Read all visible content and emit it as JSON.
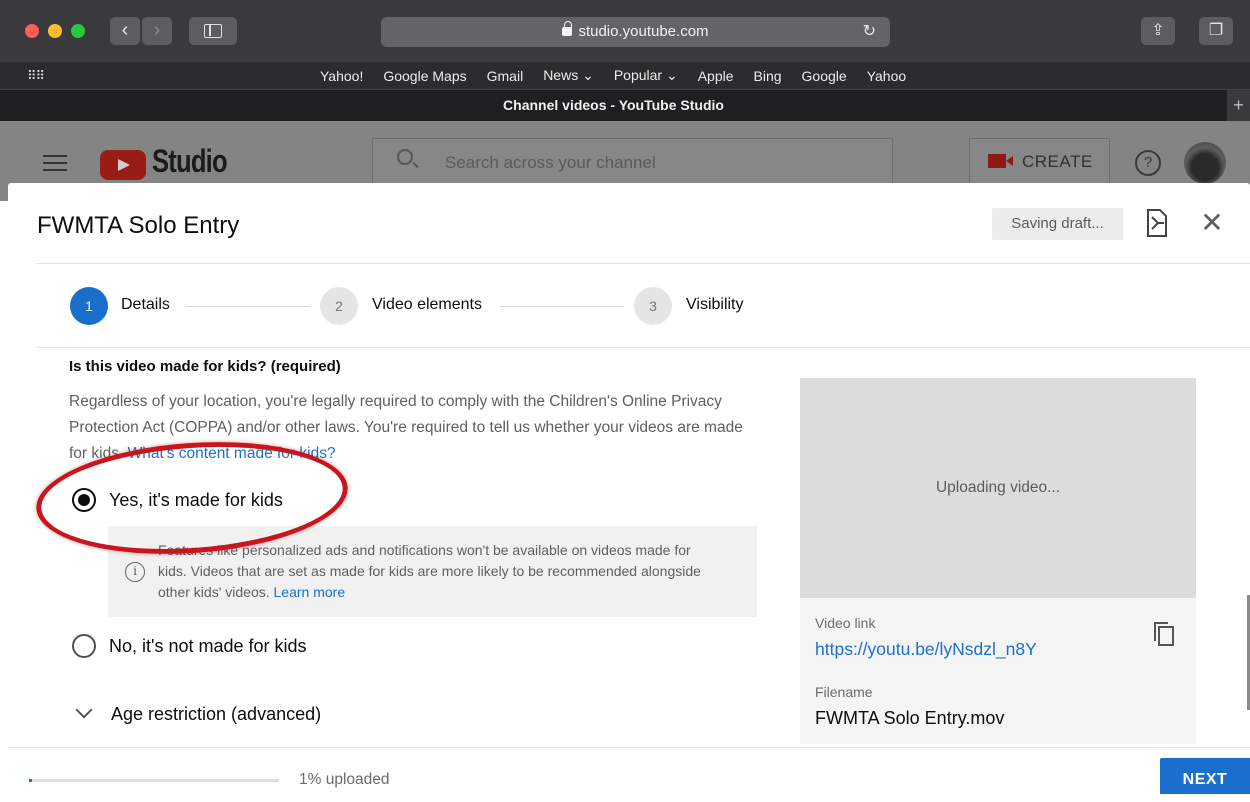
{
  "browser": {
    "url": "studio.youtube.com",
    "favorites": [
      "Yahoo!",
      "Google Maps",
      "Gmail",
      "News ⌄",
      "Popular ⌄",
      "Apple",
      "Bing",
      "Google",
      "Yahoo"
    ],
    "tab_title": "Channel videos - YouTube Studio",
    "traffic_colors": {
      "close": "#fe5f57",
      "minimize": "#febc2e",
      "zoom": "#28c840"
    }
  },
  "studio": {
    "brand": "Studio",
    "search_placeholder": "Search across your channel",
    "create_label": "CREATE",
    "help_glyph": "?"
  },
  "dialog": {
    "title": "FWMTA Solo Entry",
    "status": "Saving draft...",
    "close_glyph": "✕",
    "steps": [
      {
        "num": "1",
        "label": "Details",
        "active": true
      },
      {
        "num": "2",
        "label": "Video elements",
        "active": false
      },
      {
        "num": "3",
        "label": "Visibility",
        "active": false
      }
    ],
    "kids_question": "Is this video made for kids? (required)",
    "kids_desc": "Regardless of your location, you're legally required to comply with the Children's Online Privacy Protection Act (COPPA) and/or other laws. You're required to tell us whether your videos are made for kids. ",
    "kids_link": "What's content made for kids?",
    "option_yes": "Yes, it's made for kids",
    "option_no": "No, it's not made for kids",
    "selected_option": "yes",
    "note_text": "Features like personalized ads and notifications won't be available on videos made for kids. Videos that are set as made for kids are more likely to be recommended alongside other kids' videos. ",
    "note_link": "Learn more",
    "info_glyph": "i",
    "age_restriction": "Age restriction (advanced)",
    "preview": {
      "status": "Uploading video...",
      "link_label": "Video link",
      "link": "https://youtu.be/lyNsdzl_n8Y",
      "filename_label": "Filename",
      "filename": "FWMTA Solo Entry.mov"
    },
    "progress_fraction": 0.01,
    "progress_text": "1% uploaded",
    "next_label": "NEXT"
  },
  "colors": {
    "accent": "#1a6fcd",
    "annotation": "#c9151c",
    "yt_red": "#9a1c16"
  }
}
